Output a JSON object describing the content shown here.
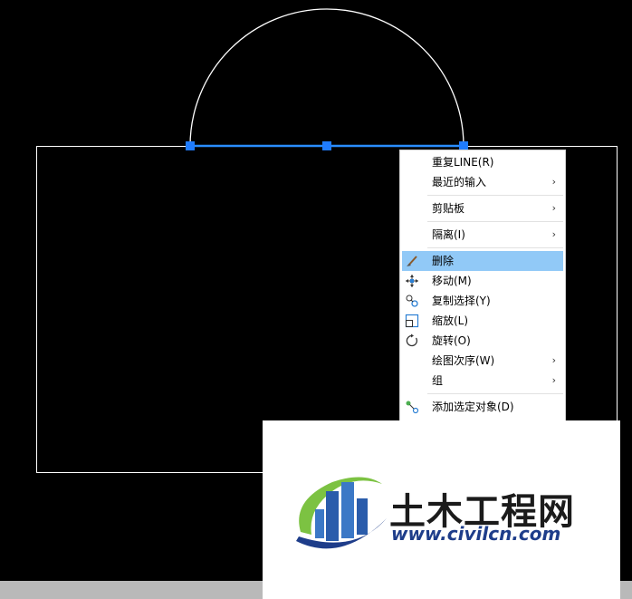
{
  "context_menu": {
    "items": [
      {
        "label": "重复LINE(R)",
        "submenu": false
      },
      {
        "label": "最近的输入",
        "submenu": true
      },
      {
        "label": "剪贴板",
        "submenu": true
      },
      {
        "label": "隔离(I)",
        "submenu": true
      },
      {
        "label": "删除",
        "icon": "eraser-icon",
        "highlighted": true
      },
      {
        "label": "移动(M)",
        "icon": "move-icon"
      },
      {
        "label": "复制选择(Y)",
        "icon": "copy-selection-icon"
      },
      {
        "label": "缩放(L)",
        "icon": "scale-icon"
      },
      {
        "label": "旋转(O)",
        "icon": "rotate-icon"
      },
      {
        "label": "绘图次序(W)",
        "submenu": true
      },
      {
        "label": "组",
        "submenu": true
      },
      {
        "label": "添加选定对象(D)",
        "icon": "add-selected-icon"
      }
    ],
    "submenu_arrow": "›"
  },
  "watermark": {
    "title": "土木工程网",
    "url": "www.civilcn.com"
  },
  "colors": {
    "background": "#000000",
    "drawing_line": "#ffffff",
    "selected_line": "#1e8cff",
    "grip": "#1f7cff",
    "menu_highlight": "#91c9f7"
  }
}
